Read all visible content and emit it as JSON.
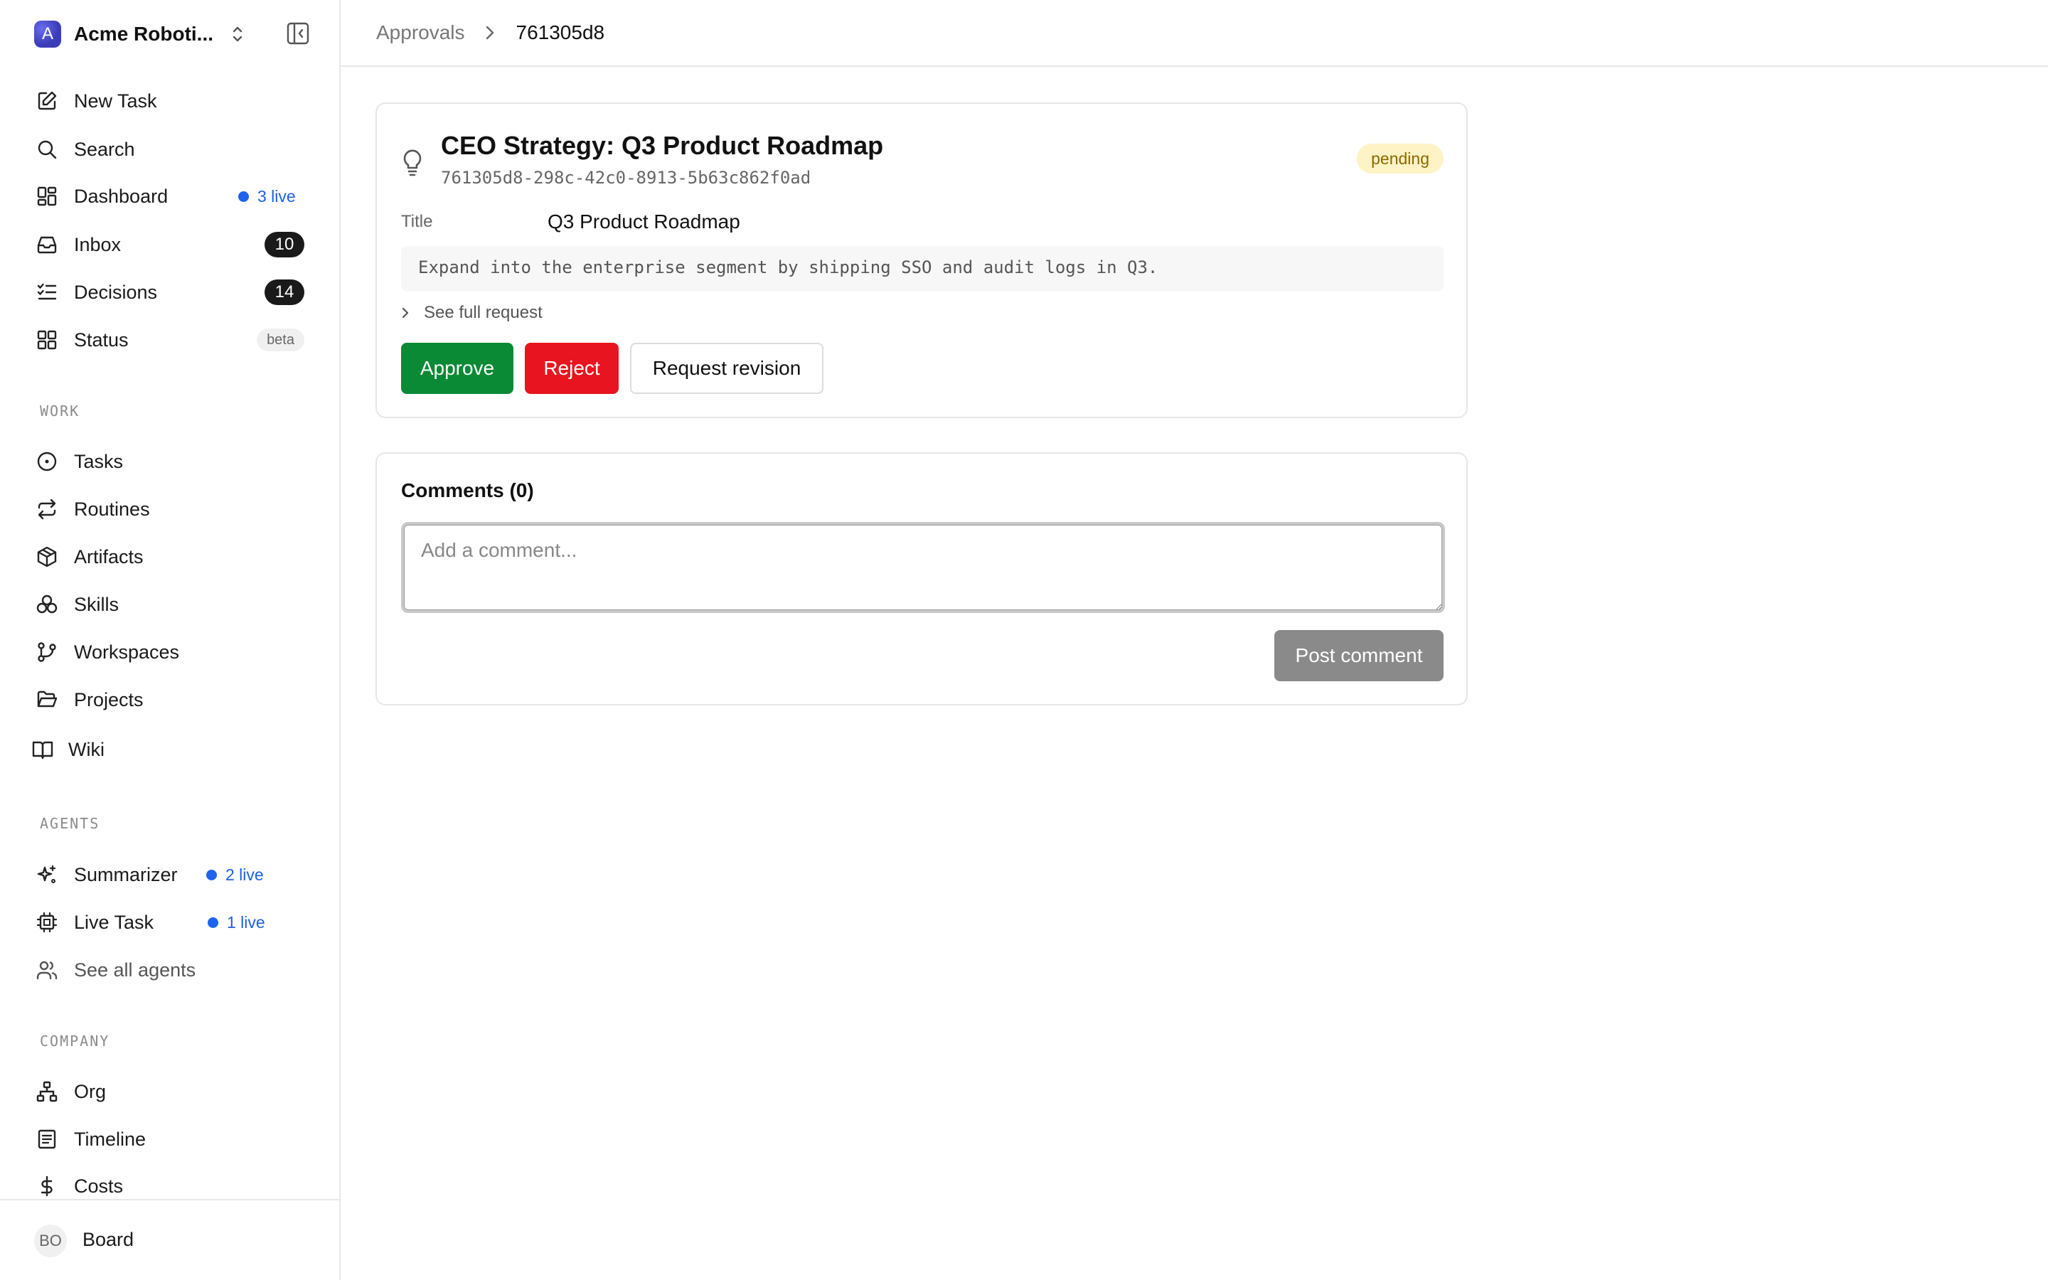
{
  "workspace": {
    "logo_letter": "A",
    "name": "Acme Roboti...",
    "icons": {
      "switcher": "chevron-up-down-icon",
      "collapse": "sidebar-collapse-icon"
    }
  },
  "nav": {
    "new_task": "New Task",
    "search": "Search",
    "dashboard": {
      "label": "Dashboard",
      "live": "3 live"
    },
    "inbox": {
      "label": "Inbox",
      "count": "10"
    },
    "decisions": {
      "label": "Decisions",
      "count": "14"
    },
    "status": {
      "label": "Status",
      "badge": "beta"
    }
  },
  "sections": {
    "work": {
      "label": "WORK",
      "items": [
        "Tasks",
        "Routines",
        "Artifacts",
        "Skills",
        "Workspaces",
        "Projects",
        "Wiki"
      ]
    },
    "agents": {
      "label": "AGENTS",
      "summarizer": {
        "label": "Summarizer",
        "live": "2 live"
      },
      "live_task": {
        "label": "Live Task",
        "live": "1 live"
      },
      "see_all": "See all agents"
    },
    "company": {
      "label": "COMPANY",
      "items": [
        "Org",
        "Timeline",
        "Costs"
      ]
    }
  },
  "user": {
    "initials": "BO",
    "name": "Board"
  },
  "breadcrumb": {
    "parent": "Approvals",
    "current": "761305d8"
  },
  "approval": {
    "title": "CEO Strategy: Q3 Product Roadmap",
    "id": "761305d8-298c-42c0-8913-5b63c862f0ad",
    "status": "pending",
    "field_label": "Title",
    "field_value": "Q3 Product Roadmap",
    "description": "Expand into the enterprise segment by shipping SSO and audit logs in Q3.",
    "see_full": "See full request",
    "buttons": {
      "approve": "Approve",
      "reject": "Reject",
      "revise": "Request revision"
    }
  },
  "comments": {
    "title": "Comments (0)",
    "placeholder": "Add a comment...",
    "post": "Post comment"
  },
  "colors": {
    "approve": "#0a8a35",
    "reject": "#e8141f",
    "live_dot": "#1d63f0",
    "pending_bg": "#fdf3c4",
    "pending_text": "#8a6a00",
    "post_disabled": "#8a8a8a"
  }
}
